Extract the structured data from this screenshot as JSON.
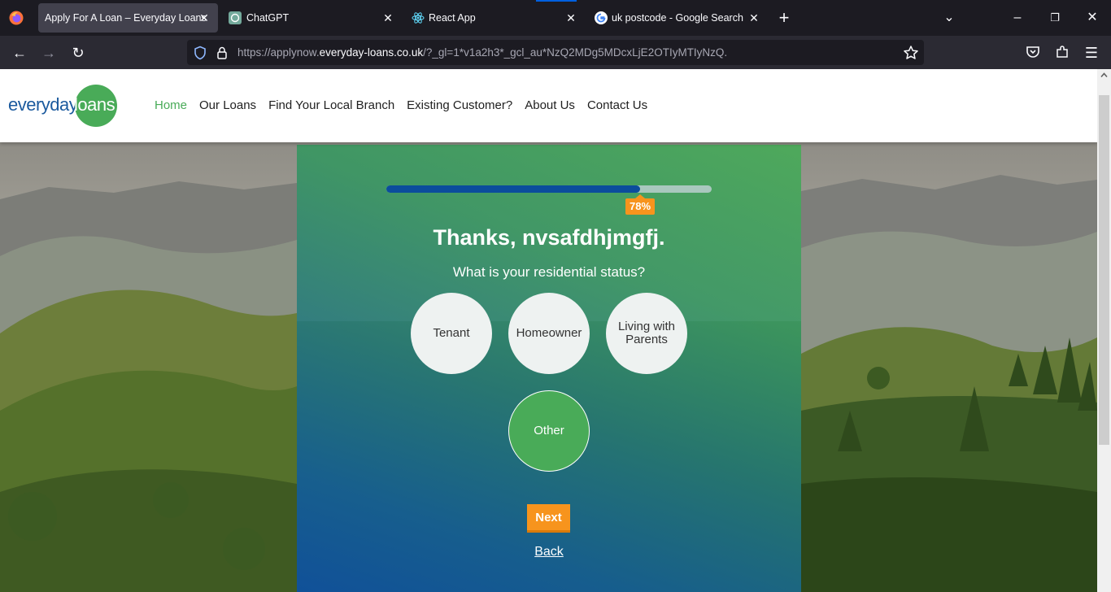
{
  "browser": {
    "tabs": [
      {
        "title": "Apply For A Loan – Everyday Loans",
        "active": true
      },
      {
        "title": "ChatGPT",
        "active": false
      },
      {
        "title": "React App",
        "active": false
      },
      {
        "title": "uk postcode - Google Search",
        "active": false
      }
    ],
    "new_tab_label": "+",
    "url": {
      "prefix": "https://applynow.",
      "domain": "everyday-loans.co.uk",
      "suffix": "/?_gl=1*v1a2h3*_gcl_au*NzQ2MDg5MDcxLjE2OTIyMTIyNzQ."
    }
  },
  "site": {
    "logo": {
      "word1": "everyday",
      "word2": "loans"
    },
    "menu": [
      "Home",
      "Our Loans",
      "Find Your Local Branch",
      "Existing Customer?",
      "About Us",
      "Contact Us"
    ],
    "active_menu": "Home"
  },
  "form": {
    "progress": {
      "percent": 78,
      "label": "78%"
    },
    "greeting": "Thanks, nvsafdhjmgfj.",
    "question": "What is your residential status?",
    "options": [
      "Tenant",
      "Homeowner",
      "Living with Parents",
      "Other"
    ],
    "selected_option": "Other",
    "next_label": "Next",
    "back_label": "Back"
  },
  "colors": {
    "brand_green": "#49ab58",
    "brand_blue": "#1b5a9e",
    "accent_orange": "#f7941d",
    "progress_blue": "#0b4d9c"
  }
}
